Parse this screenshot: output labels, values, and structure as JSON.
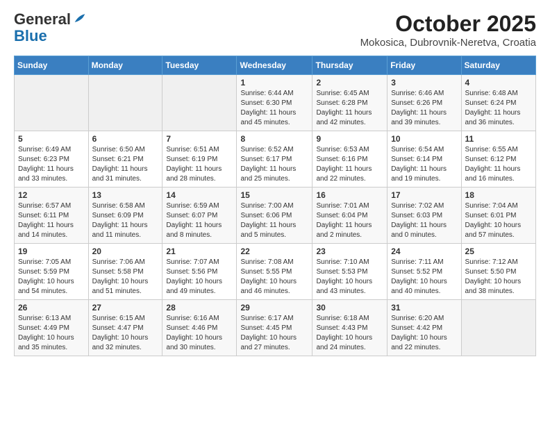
{
  "header": {
    "logo_general": "General",
    "logo_blue": "Blue",
    "title": "October 2025",
    "subtitle": "Mokosica, Dubrovnik-Neretva, Croatia"
  },
  "weekdays": [
    "Sunday",
    "Monday",
    "Tuesday",
    "Wednesday",
    "Thursday",
    "Friday",
    "Saturday"
  ],
  "weeks": [
    [
      {
        "day": "",
        "info": ""
      },
      {
        "day": "",
        "info": ""
      },
      {
        "day": "",
        "info": ""
      },
      {
        "day": "1",
        "info": "Sunrise: 6:44 AM\nSunset: 6:30 PM\nDaylight: 11 hours and 45 minutes."
      },
      {
        "day": "2",
        "info": "Sunrise: 6:45 AM\nSunset: 6:28 PM\nDaylight: 11 hours and 42 minutes."
      },
      {
        "day": "3",
        "info": "Sunrise: 6:46 AM\nSunset: 6:26 PM\nDaylight: 11 hours and 39 minutes."
      },
      {
        "day": "4",
        "info": "Sunrise: 6:48 AM\nSunset: 6:24 PM\nDaylight: 11 hours and 36 minutes."
      }
    ],
    [
      {
        "day": "5",
        "info": "Sunrise: 6:49 AM\nSunset: 6:23 PM\nDaylight: 11 hours and 33 minutes."
      },
      {
        "day": "6",
        "info": "Sunrise: 6:50 AM\nSunset: 6:21 PM\nDaylight: 11 hours and 31 minutes."
      },
      {
        "day": "7",
        "info": "Sunrise: 6:51 AM\nSunset: 6:19 PM\nDaylight: 11 hours and 28 minutes."
      },
      {
        "day": "8",
        "info": "Sunrise: 6:52 AM\nSunset: 6:17 PM\nDaylight: 11 hours and 25 minutes."
      },
      {
        "day": "9",
        "info": "Sunrise: 6:53 AM\nSunset: 6:16 PM\nDaylight: 11 hours and 22 minutes."
      },
      {
        "day": "10",
        "info": "Sunrise: 6:54 AM\nSunset: 6:14 PM\nDaylight: 11 hours and 19 minutes."
      },
      {
        "day": "11",
        "info": "Sunrise: 6:55 AM\nSunset: 6:12 PM\nDaylight: 11 hours and 16 minutes."
      }
    ],
    [
      {
        "day": "12",
        "info": "Sunrise: 6:57 AM\nSunset: 6:11 PM\nDaylight: 11 hours and 14 minutes."
      },
      {
        "day": "13",
        "info": "Sunrise: 6:58 AM\nSunset: 6:09 PM\nDaylight: 11 hours and 11 minutes."
      },
      {
        "day": "14",
        "info": "Sunrise: 6:59 AM\nSunset: 6:07 PM\nDaylight: 11 hours and 8 minutes."
      },
      {
        "day": "15",
        "info": "Sunrise: 7:00 AM\nSunset: 6:06 PM\nDaylight: 11 hours and 5 minutes."
      },
      {
        "day": "16",
        "info": "Sunrise: 7:01 AM\nSunset: 6:04 PM\nDaylight: 11 hours and 2 minutes."
      },
      {
        "day": "17",
        "info": "Sunrise: 7:02 AM\nSunset: 6:03 PM\nDaylight: 11 hours and 0 minutes."
      },
      {
        "day": "18",
        "info": "Sunrise: 7:04 AM\nSunset: 6:01 PM\nDaylight: 10 hours and 57 minutes."
      }
    ],
    [
      {
        "day": "19",
        "info": "Sunrise: 7:05 AM\nSunset: 5:59 PM\nDaylight: 10 hours and 54 minutes."
      },
      {
        "day": "20",
        "info": "Sunrise: 7:06 AM\nSunset: 5:58 PM\nDaylight: 10 hours and 51 minutes."
      },
      {
        "day": "21",
        "info": "Sunrise: 7:07 AM\nSunset: 5:56 PM\nDaylight: 10 hours and 49 minutes."
      },
      {
        "day": "22",
        "info": "Sunrise: 7:08 AM\nSunset: 5:55 PM\nDaylight: 10 hours and 46 minutes."
      },
      {
        "day": "23",
        "info": "Sunrise: 7:10 AM\nSunset: 5:53 PM\nDaylight: 10 hours and 43 minutes."
      },
      {
        "day": "24",
        "info": "Sunrise: 7:11 AM\nSunset: 5:52 PM\nDaylight: 10 hours and 40 minutes."
      },
      {
        "day": "25",
        "info": "Sunrise: 7:12 AM\nSunset: 5:50 PM\nDaylight: 10 hours and 38 minutes."
      }
    ],
    [
      {
        "day": "26",
        "info": "Sunrise: 6:13 AM\nSunset: 4:49 PM\nDaylight: 10 hours and 35 minutes."
      },
      {
        "day": "27",
        "info": "Sunrise: 6:15 AM\nSunset: 4:47 PM\nDaylight: 10 hours and 32 minutes."
      },
      {
        "day": "28",
        "info": "Sunrise: 6:16 AM\nSunset: 4:46 PM\nDaylight: 10 hours and 30 minutes."
      },
      {
        "day": "29",
        "info": "Sunrise: 6:17 AM\nSunset: 4:45 PM\nDaylight: 10 hours and 27 minutes."
      },
      {
        "day": "30",
        "info": "Sunrise: 6:18 AM\nSunset: 4:43 PM\nDaylight: 10 hours and 24 minutes."
      },
      {
        "day": "31",
        "info": "Sunrise: 6:20 AM\nSunset: 4:42 PM\nDaylight: 10 hours and 22 minutes."
      },
      {
        "day": "",
        "info": ""
      }
    ]
  ]
}
